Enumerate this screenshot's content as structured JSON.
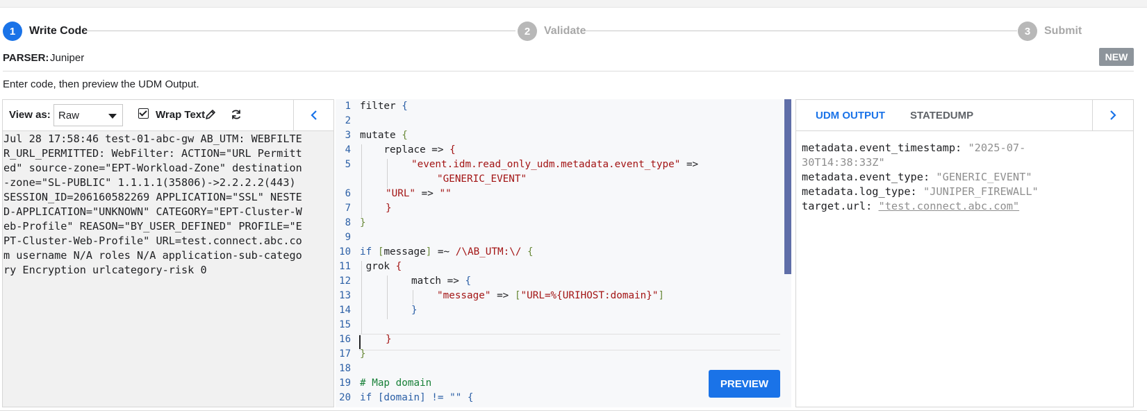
{
  "stepper": {
    "steps": [
      {
        "number": "1",
        "label": "Write Code"
      },
      {
        "number": "2",
        "label": "Validate"
      },
      {
        "number": "3",
        "label": "Submit"
      }
    ]
  },
  "parser": {
    "key": "PARSER:",
    "value": "Juniper",
    "badge": "NEW"
  },
  "instruction": "Enter code, then preview the UDM Output.",
  "left_panel": {
    "view_as_label": "View as:",
    "view_as_value": "Raw",
    "wrap_text_label": "Wrap Text",
    "wrap_text_checked": true,
    "log_lines": [
      "Jul 28 17:58:46 test-01-abc-gw AB_UTM: WEBFILTE",
      "R_URL_PERMITTED: WebFilter: ACTION=\"URL Permitt",
      "ed\" source-zone=\"EPT-Workload-Zone\" destination",
      "-zone=\"SL-PUBLIC\" 1.1.1.1(35806)->2.2.2.2(443)",
      "SESSION_ID=206160582269 APPLICATION=\"SSL\" NESTE",
      "D-APPLICATION=\"UNKNOWN\" CATEGORY=\"EPT-Cluster-W",
      "eb-Profile\" REASON=\"BY_USER_DEFINED\" PROFILE=\"E",
      "PT-Cluster-Web-Profile\" URL=test.connect.abc.co",
      "m username N/A roles N/A application-sub-catego",
      "ry Encryption urlcategory-risk 0"
    ]
  },
  "editor": {
    "line_numbers": [
      "1",
      "2",
      "3",
      "4",
      "5",
      "",
      "6",
      "7",
      "8",
      "9",
      "10",
      "11",
      "12",
      "13",
      "14",
      "15",
      "16",
      "17",
      "18",
      "19",
      "20"
    ],
    "code": {
      "l1_kw": "filter ",
      "l1_brace": "{",
      "l3_kw": "mutate ",
      "l3_brace": "{",
      "l4_kw": "    replace => ",
      "l4_brace": "{",
      "l5_str": "\"event.idm.read_only_udm.metadata.event_type\"",
      "l5_op": " =>",
      "l5b_str": "\"GENERIC_EVENT\"",
      "l6_str1": "\"URL\"",
      "l6_op": " => ",
      "l6_str2": "\"\"",
      "l7_brace": "}",
      "l8_brace": "}",
      "l10_kw": "if ",
      "l10_b1": "[",
      "l10_field": "message",
      "l10_b2": "]",
      "l10_op": " =~ ",
      "l10_regex": "/\\AB_UTM:\\/",
      "l10_brace": " {",
      "l11_kw": " grok ",
      "l11_brace": "{",
      "l12_kw": "match => ",
      "l12_brace": "{",
      "l13_str": "\"message\"",
      "l13_op": " => ",
      "l13_b1": "[",
      "l13_str2": "\"URL=%{URIHOST:domain}\"",
      "l13_b2": "]",
      "l14_brace": "}",
      "l16_brace": "}",
      "l17_brace": "}",
      "l19_comment": "# Map domain",
      "l20_text": "if [domain] != \"\" {"
    },
    "preview_label": "PREVIEW"
  },
  "right_panel": {
    "tabs": [
      {
        "label": "UDM OUTPUT",
        "active": true
      },
      {
        "label": "STATEDUMP",
        "active": false
      }
    ],
    "output": {
      "l1_key": "metadata.event_timestamp: ",
      "l1_val": "\"2025-07-",
      "l2_val": "30T14:38:33Z\"",
      "l3_key": "metadata.event_type: ",
      "l3_val": "\"GENERIC_EVENT\"",
      "l4_key": "metadata.log_type: ",
      "l4_val": "\"JUNIPER_FIREWALL\"",
      "l5_key": "target.url: ",
      "l5_val": "\"test.connect.abc.com\""
    }
  },
  "icons": {
    "edit": "pencil-icon",
    "refresh": "refresh-icon",
    "collapse_left": "chevron-left-icon",
    "collapse_right": "chevron-right-icon"
  },
  "colors": {
    "accent": "#1a73e8",
    "badge": "#8d949b",
    "scrollbar": "#5f6ea8",
    "string": "#a31515",
    "comment": "#188038"
  }
}
